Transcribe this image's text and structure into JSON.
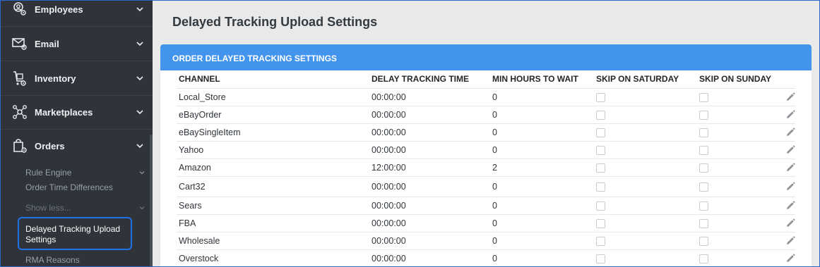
{
  "sidebar": {
    "items": [
      {
        "label": "Employees",
        "icon": "employees-settings-icon"
      },
      {
        "label": "Email",
        "icon": "email-settings-icon"
      },
      {
        "label": "Inventory",
        "icon": "inventory-settings-icon"
      },
      {
        "label": "Marketplaces",
        "icon": "marketplaces-settings-icon"
      },
      {
        "label": "Orders",
        "icon": "orders-settings-icon"
      }
    ],
    "sub_items": {
      "rule_engine": "Rule Engine",
      "order_time_differences": "Order Time Differences",
      "show_less": "Show less...",
      "active": "Delayed Tracking Upload Settings",
      "rma_reasons": "RMA Reasons"
    }
  },
  "page": {
    "title": "Delayed Tracking Upload Settings"
  },
  "card": {
    "header": "ORDER DELAYED TRACKING SETTINGS",
    "columns": [
      "CHANNEL",
      "DELAY TRACKING TIME",
      "MIN HOURS TO WAIT",
      "SKIP ON SATURDAY",
      "SKIP ON SUNDAY"
    ],
    "rows": [
      {
        "channel": "Local_Store",
        "delay": "00:00:00",
        "min_hours": "0",
        "skip_sat": false,
        "skip_sun": false
      },
      {
        "channel": "eBayOrder",
        "delay": "00:00:00",
        "min_hours": "0",
        "skip_sat": false,
        "skip_sun": false
      },
      {
        "channel": "eBaySingleItem",
        "delay": "00:00:00",
        "min_hours": "0",
        "skip_sat": false,
        "skip_sun": false
      },
      {
        "channel": "Yahoo",
        "delay": "00:00:00",
        "min_hours": "0",
        "skip_sat": false,
        "skip_sun": false
      },
      {
        "channel": "Amazon",
        "delay": "12:00:00",
        "min_hours": "2",
        "skip_sat": false,
        "skip_sun": false
      },
      {
        "channel": "Cart32",
        "delay": "00:00:00",
        "min_hours": "0",
        "skip_sat": false,
        "skip_sun": false
      },
      {
        "channel": "Sears",
        "delay": "00:00:00",
        "min_hours": "0",
        "skip_sat": false,
        "skip_sun": false
      },
      {
        "channel": "FBA",
        "delay": "00:00:00",
        "min_hours": "0",
        "skip_sat": false,
        "skip_sun": false
      },
      {
        "channel": "Wholesale",
        "delay": "00:00:00",
        "min_hours": "0",
        "skip_sat": false,
        "skip_sun": false
      },
      {
        "channel": "Overstock",
        "delay": "00:00:00",
        "min_hours": "0",
        "skip_sat": false,
        "skip_sun": false
      }
    ],
    "row_action_icon": "pencil-edit-icon"
  },
  "colors": {
    "sidebar_bg": "#2f343b",
    "header_blue": "#4394ec",
    "active_border": "#1e73e8",
    "page_bg": "#e9e9e9"
  }
}
